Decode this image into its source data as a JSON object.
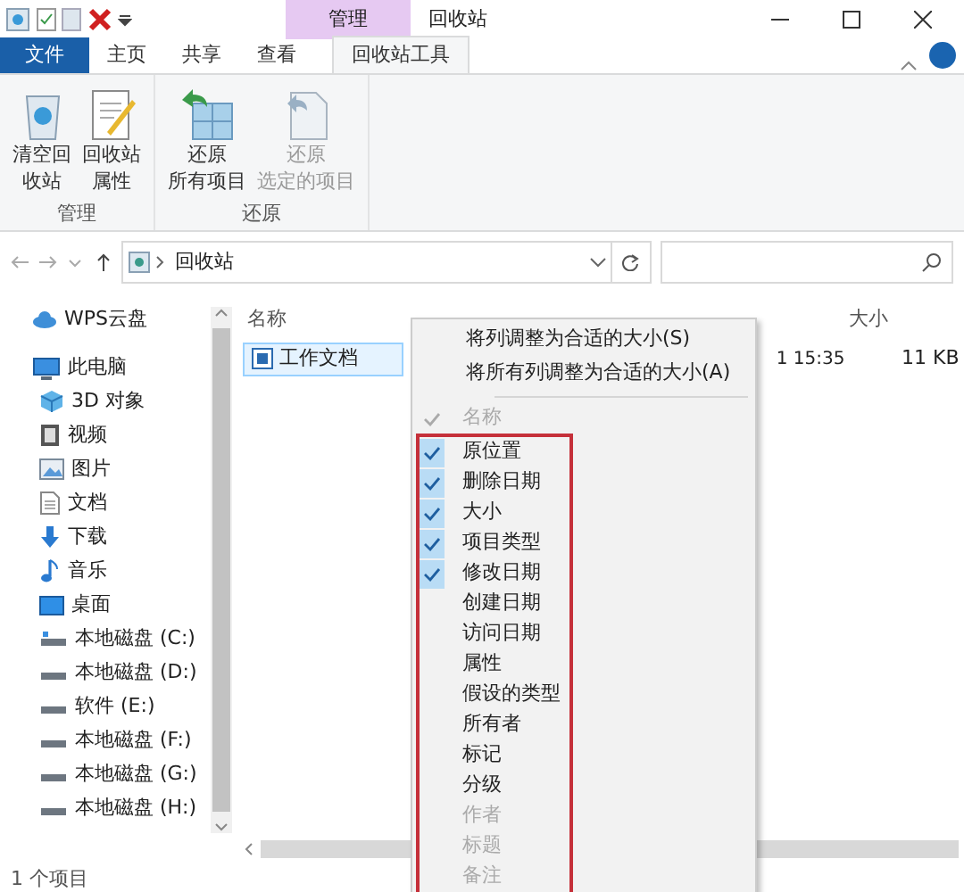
{
  "window": {
    "title": "回收站",
    "context_tab_group": "管理"
  },
  "ribbon_tabs": [
    {
      "label": "文件",
      "kind": "file",
      "selected": false
    },
    {
      "label": "主页",
      "kind": "tab",
      "selected": false
    },
    {
      "label": "共享",
      "kind": "tab",
      "selected": false
    },
    {
      "label": "查看",
      "kind": "tab",
      "selected": false
    },
    {
      "label": "回收站工具",
      "kind": "tab",
      "selected": true
    }
  ],
  "ribbon_groups": [
    {
      "label": "管理",
      "buttons": [
        {
          "lines": [
            "清空回",
            "收站"
          ],
          "disabled": false
        },
        {
          "lines": [
            "回收站",
            "属性"
          ],
          "disabled": false
        }
      ]
    },
    {
      "label": "还原",
      "buttons": [
        {
          "lines": [
            "还原",
            "所有项目"
          ],
          "disabled": false
        },
        {
          "lines": [
            "还原",
            "选定的项目"
          ],
          "disabled": true
        }
      ]
    }
  ],
  "address_bar": {
    "path": "回收站"
  },
  "nav_pane": [
    {
      "label": "WPS云盘"
    },
    {
      "label": "此电脑",
      "children": [
        {
          "label": "3D 对象"
        },
        {
          "label": "视频"
        },
        {
          "label": "图片"
        },
        {
          "label": "文档"
        },
        {
          "label": "下载"
        },
        {
          "label": "音乐"
        },
        {
          "label": "桌面"
        },
        {
          "label": "本地磁盘 (C:)"
        },
        {
          "label": "本地磁盘 (D:)"
        },
        {
          "label": "软件 (E:)"
        },
        {
          "label": "本地磁盘 (F:)"
        },
        {
          "label": "本地磁盘 (G:)"
        },
        {
          "label": "本地磁盘 (H:)"
        }
      ]
    }
  ],
  "file_list": {
    "columns": [
      "名称",
      "大小"
    ],
    "rows": [
      {
        "name": "工作文档",
        "column_2": "1 15:35",
        "size": "11 KB",
        "selected": true
      }
    ]
  },
  "context_menu": {
    "commands": [
      "将列调整为合适的大小(S)",
      "将所有列调整为合适的大小(A)"
    ],
    "highlight_frame": true,
    "column_options": [
      {
        "label": "名称",
        "checked": true,
        "disabled": true
      },
      {
        "label": "原位置",
        "checked": true,
        "disabled": false
      },
      {
        "label": "删除日期",
        "checked": true,
        "disabled": false
      },
      {
        "label": "大小",
        "checked": true,
        "disabled": false
      },
      {
        "label": "项目类型",
        "checked": true,
        "disabled": false
      },
      {
        "label": "修改日期",
        "checked": true,
        "disabled": false
      },
      {
        "label": "创建日期",
        "checked": false,
        "disabled": false
      },
      {
        "label": "访问日期",
        "checked": false,
        "disabled": false
      },
      {
        "label": "属性",
        "checked": false,
        "disabled": false
      },
      {
        "label": "假设的类型",
        "checked": false,
        "disabled": false
      },
      {
        "label": "所有者",
        "checked": false,
        "disabled": false
      },
      {
        "label": "标记",
        "checked": false,
        "disabled": false
      },
      {
        "label": "分级",
        "checked": false,
        "disabled": false
      },
      {
        "label": "作者",
        "checked": false,
        "disabled": true
      },
      {
        "label": "标题",
        "checked": false,
        "disabled": true
      },
      {
        "label": "备注",
        "checked": false,
        "disabled": true
      }
    ]
  },
  "status_bar": {
    "text": "1 个项目"
  }
}
